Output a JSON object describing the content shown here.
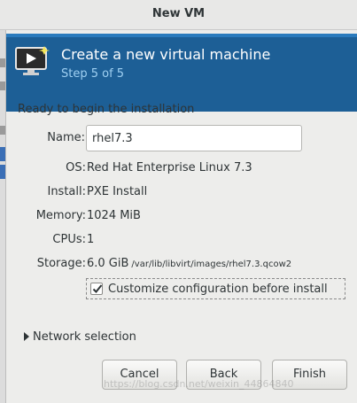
{
  "window": {
    "title": "New VM"
  },
  "banner": {
    "heading": "Create a new virtual machine",
    "step": "Step 5 of 5",
    "icon": "monitor-play-icon"
  },
  "summary": {
    "ready_text": "Ready to begin the installation",
    "name_label": "Name:",
    "name_value": "rhel7.3",
    "os_label": "OS:",
    "os_value": "Red Hat Enterprise Linux 7.3",
    "install_label": "Install:",
    "install_value": "PXE Install",
    "memory_label": "Memory:",
    "memory_value": "1024 MiB",
    "cpus_label": "CPUs:",
    "cpus_value": "1",
    "storage_label": "Storage:",
    "storage_value": "6.0 GiB",
    "storage_path": "/var/lib/libvirt/images/rhel7.3.qcow2"
  },
  "customize": {
    "label": "Customize configuration before install",
    "checked": true
  },
  "network": {
    "label": "Network selection"
  },
  "buttons": {
    "cancel": "Cancel",
    "back": "Back",
    "finish": "Finish"
  },
  "watermark": "https://blog.csdn.net/weixin_44864840",
  "colors": {
    "banner": "#1d5f96",
    "banner_step": "#9fd0f2",
    "background": "#ededeb"
  }
}
